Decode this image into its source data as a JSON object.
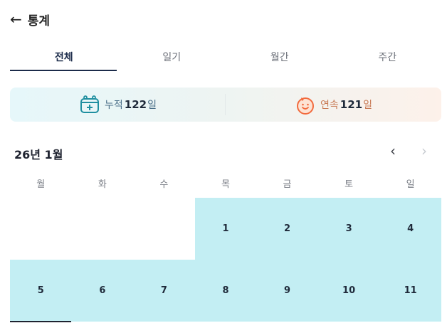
{
  "header": {
    "title": "통계"
  },
  "tabs": [
    {
      "label": "전체",
      "active": true
    },
    {
      "label": "일기",
      "active": false
    },
    {
      "label": "월간",
      "active": false
    },
    {
      "label": "주간",
      "active": false
    }
  ],
  "stats": {
    "cumulative": {
      "label": "누적",
      "value": "122",
      "unit": "일"
    },
    "streak": {
      "label": "연속",
      "value": "121",
      "unit": "일"
    }
  },
  "calendar": {
    "month_label": "26년 1월",
    "prev_icon": "chevron-left-icon",
    "next_icon": "chevron-right-icon",
    "weekdays": [
      "월",
      "화",
      "수",
      "목",
      "금",
      "토",
      "일"
    ],
    "weeks": [
      [
        "",
        "",
        "",
        "1",
        "2",
        "3",
        "4"
      ],
      [
        "5",
        "6",
        "7",
        "8",
        "9",
        "10",
        "11"
      ]
    ]
  },
  "colors": {
    "accent": "#1b2b4a",
    "filled_day": "#c3eef3",
    "streak_orange": "#f26a3d",
    "calendar_teal": "#1f8fa0"
  }
}
